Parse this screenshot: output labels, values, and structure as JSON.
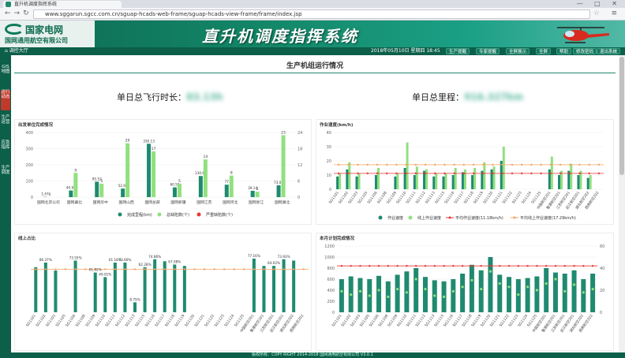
{
  "browser": {
    "tab_title": "直升机调度指挥系统",
    "url": "www.sggarun.sgcc.com.cn/sguap-hcads-web-frame/sguap-hcads-view-frame/frame/index.jsp"
  },
  "header": {
    "logo_main": "国家电网",
    "logo_sub": "国网通用航空有限公司",
    "system_title": "直升机调度指挥系统"
  },
  "toolbar": {
    "user": "调控大厅",
    "datetime": "2018年05月10日 星期四 18:45",
    "buttons": [
      "生产提醒",
      "专家提醒",
      "全屏展示",
      "全屏",
      "帮助",
      "修改密码",
      "退出系统"
    ]
  },
  "sidebar": [
    {
      "label": "GIS地图",
      "active": false
    },
    {
      "label": "运行动态",
      "active": true
    },
    {
      "label": "生产运营",
      "active": false
    },
    {
      "label": "应急指挥",
      "active": false
    },
    {
      "label": "生产调度",
      "active": false
    }
  ],
  "section": {
    "title": "生产机组运行情况"
  },
  "stats": {
    "flight_label": "单日总飞行时长：",
    "flight_value": "83.13h",
    "mileage_label": "单日总里程：",
    "mileage_value": "916.327km"
  },
  "footer": "版权所有：COPY RIGHT 2014-2018 国网通用航空有限公司 V3.0.1",
  "colors": {
    "dark": "#1f8a70",
    "light": "#91e07e",
    "red": "#e53935",
    "orange": "#f4a460"
  },
  "chart_data": [
    {
      "type": "bar",
      "title": "出发单位完成情况",
      "categories": [
        "国网北京公司",
        "国网冀北",
        "国网华中",
        "国网山西",
        "国网总部",
        "国网新疆",
        "国网江苏",
        "国网河北",
        "国网浙江",
        "国网湖北"
      ],
      "series": [
        {
          "name": "完成里程(km)",
          "axis": "left",
          "values": [
            1.47,
            40.96,
            95.52,
            52.92,
            330.13,
            60.59,
            130.61,
            77,
            39.14,
            73.03
          ]
        },
        {
          "name": "总缺陷数(个)",
          "axis": "right",
          "values": [
            0,
            9,
            5,
            20,
            17,
            5,
            14,
            8,
            2,
            23
          ]
        },
        {
          "name": "严重缺陷数(个)",
          "axis": "right",
          "values": [
            0,
            0,
            0,
            0,
            0,
            0,
            0,
            0,
            0,
            0
          ]
        }
      ],
      "yleft": [
        0,
        400
      ],
      "yright": [
        0,
        24
      ]
    },
    {
      "type": "bar",
      "title": "作业速度(km/h)",
      "categories": [
        "SG1101",
        "SG1102",
        "SG1103",
        "SG1105",
        "SG1106",
        "SG1108",
        "SG1109",
        "SG1110",
        "SG1111",
        "SG1112",
        "SG1113",
        "SG1115",
        "SG1116",
        "SG1117",
        "SG1118",
        "SG1119",
        "SG1120",
        "SG1121",
        "SG1122",
        "SG1123",
        "SG1124",
        "SG1125",
        "中国航空201",
        "鲁港航空201",
        "江苏航空201",
        "武汉航空201",
        "湖北航空202",
        "西南航空202"
      ],
      "series": [
        {
          "name": "作业速度",
          "values": [
            9,
            14,
            9,
            0,
            10,
            0,
            9,
            15,
            10,
            13,
            9,
            9,
            10,
            12,
            10,
            13,
            14,
            20,
            0,
            0,
            0,
            0,
            14,
            10,
            13,
            10,
            8,
            0
          ],
          "hideZero": true
        },
        {
          "name": "线上作业速度",
          "values": [
            11,
            19,
            11,
            0,
            15,
            0,
            11,
            33,
            16,
            14,
            11,
            11,
            15,
            14,
            15,
            19,
            16,
            30,
            0,
            0,
            0,
            0,
            23,
            13,
            18,
            13,
            10,
            0
          ],
          "hideZero": true
        },
        {
          "name": "平均作业速度(11.18km/h)",
          "type": "line",
          "value": 11.18
        },
        {
          "name": "平均线上作业速度(17.29km/h)",
          "type": "line",
          "value": 17.29
        }
      ],
      "ylim": [
        0,
        40
      ],
      "yticks": [
        0,
        10,
        20,
        30,
        40
      ]
    },
    {
      "type": "bar",
      "title": "线上占比",
      "categories": [
        "SG1101",
        "SG1102",
        "SG1103",
        "SG1105",
        "SG1106",
        "SG1108",
        "SG1109",
        "SG1110",
        "SG1111",
        "SG1112",
        "SG1113",
        "SG1115",
        "SG1116",
        "SG1117",
        "SG1118",
        "SG1119",
        "SG1120",
        "SG1121",
        "SG1122",
        "SG1123",
        "SG1124",
        "SG1125",
        "中国航空201",
        "鲁港航空201",
        "江苏航空201",
        "武汉航空201",
        "湖北航空202",
        "西南航空202"
      ],
      "series": [
        {
          "name": "线上占比",
          "values": [
            68,
            75,
            63,
            0,
            78,
            0,
            60,
            53,
            75,
            75,
            15,
            68,
            80,
            77,
            72,
            70,
            0,
            0,
            0,
            0,
            0,
            0,
            81,
            70,
            70,
            80,
            78,
            0
          ],
          "hideZero": true
        },
        {
          "name": "平均线",
          "type": "line",
          "value": 65
        }
      ],
      "labels": [
        [
          1,
          "80.37%"
        ],
        [
          4,
          "73.55%"
        ],
        [
          6,
          "61.02%"
        ],
        [
          7,
          "49.91%"
        ],
        [
          8,
          "61.18%"
        ],
        [
          9,
          "73.60%"
        ],
        [
          10,
          "8.75%"
        ],
        [
          11,
          "62.28%"
        ],
        [
          12,
          "74.86%"
        ],
        [
          14,
          "67.08%"
        ],
        [
          22,
          "77.16%"
        ],
        [
          24,
          "64.02%"
        ],
        [
          25,
          "73.93%"
        ]
      ],
      "ylim": [
        0,
        100
      ]
    },
    {
      "type": "bar",
      "title": "本月计划完成情况",
      "categories": [
        "SG1101",
        "SG1102",
        "SG1103",
        "SG1105",
        "SG1106",
        "SG1108",
        "SG1109",
        "SG1110",
        "SG1111",
        "SG1112",
        "SG1113",
        "SG1115",
        "SG1116",
        "SG1117",
        "SG1118",
        "SG1119",
        "SG1120",
        "SG1121",
        "SG1122",
        "SG1123",
        "SG1124",
        "SG1125",
        "中国航空201",
        "鲁港航空201",
        "江苏航空201",
        "武汉航空201",
        "湖北航空202",
        "西南航空202"
      ],
      "series": [
        {
          "name": "计划",
          "axis": "left",
          "values": [
            600,
            650,
            620,
            600,
            660,
            560,
            680,
            740,
            800,
            640,
            580,
            560,
            600,
            700,
            860,
            760,
            1000,
            680,
            640,
            600,
            620,
            650,
            800,
            720,
            700,
            760,
            600,
            700
          ]
        },
        {
          "name": "完成",
          "axis": "left",
          "values": [
            380,
            320,
            380,
            300,
            400,
            280,
            420,
            360,
            600,
            420,
            300,
            280,
            380,
            460,
            580,
            420,
            740,
            520,
            460,
            320,
            460,
            400,
            520,
            600,
            380,
            500,
            360,
            420
          ]
        },
        {
          "name": "平均线",
          "type": "line",
          "axis": "right",
          "value": 42
        }
      ],
      "yleft": [
        0,
        1200
      ],
      "yright": [
        0,
        60
      ]
    }
  ]
}
